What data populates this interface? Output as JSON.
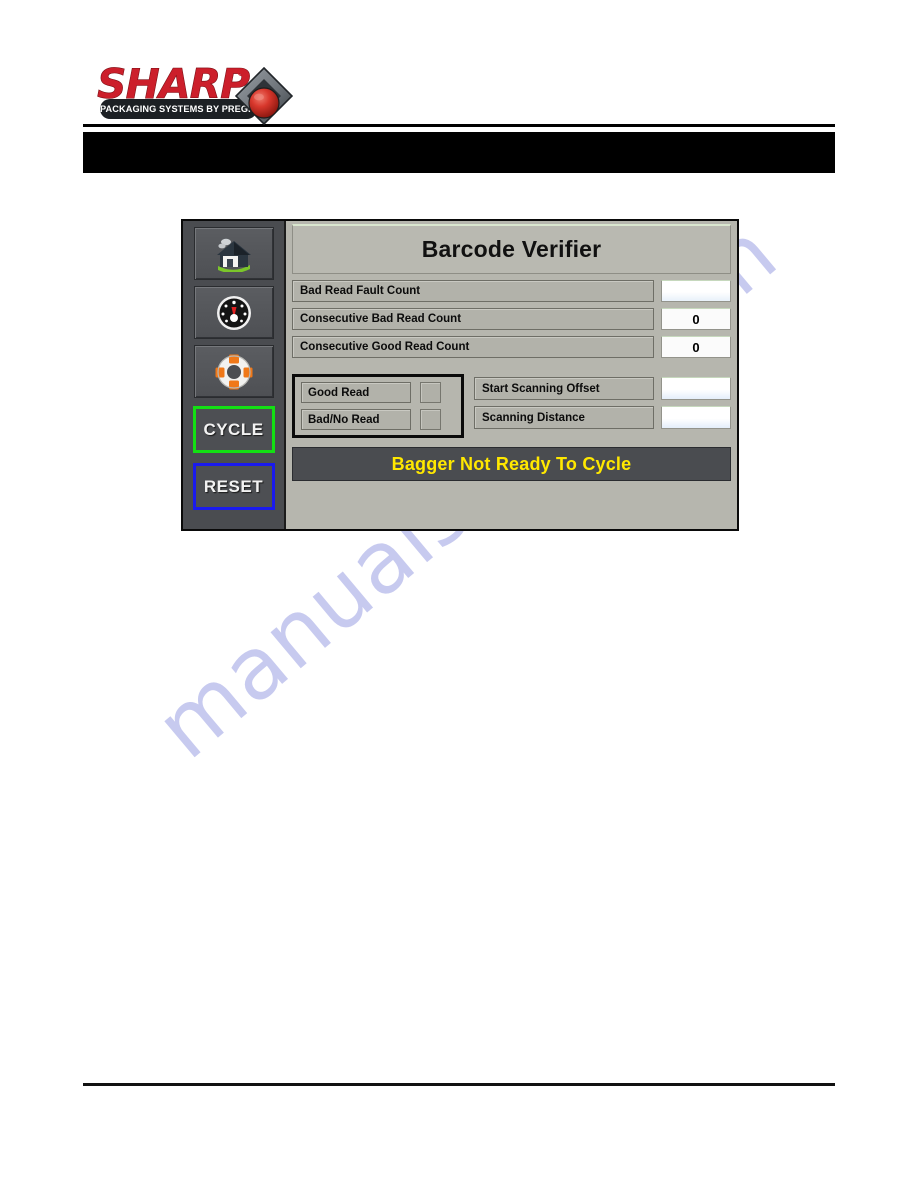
{
  "watermark": {
    "text": "manualshive.com"
  },
  "logo": {
    "brand": "SHARP",
    "registered_mark": "®",
    "tagline": "PACKAGING SYSTEMS BY PREGIS",
    "brand_color": "#cc1f2b",
    "tagline_bg": "#1c2024",
    "diamond_icon": "diamond-sphere-icon"
  },
  "header": {
    "bar_color": "#000000",
    "title": ""
  },
  "hmi": {
    "panel_title": "Barcode Verifier",
    "sidebar": {
      "nav_buttons": [
        {
          "icon": "home-icon",
          "label": "Home"
        },
        {
          "icon": "gauge-icon",
          "label": "Dashboard"
        },
        {
          "icon": "life-ring-icon",
          "label": "Help"
        }
      ],
      "action_buttons": [
        {
          "label": "CYCLE",
          "border_color": "#13e013"
        },
        {
          "label": "RESET",
          "border_color": "#1a1aee"
        }
      ]
    },
    "counters": [
      {
        "label": "Bad Read Fault Count",
        "value": ""
      },
      {
        "label": "Consecutive Bad Read Count",
        "value": "0"
      },
      {
        "label": "Consecutive Good Read Count",
        "value": "0"
      }
    ],
    "read_status": [
      {
        "label": "Good Read",
        "state": "off"
      },
      {
        "label": "Bad/No Read",
        "state": "off"
      }
    ],
    "scan_params": [
      {
        "label": "Start Scanning Offset",
        "value": ""
      },
      {
        "label": "Scanning Distance",
        "value": ""
      }
    ],
    "status_banner": {
      "text": "Bagger Not Ready To Cycle",
      "text_color": "#ffe800",
      "bg_color": "#4a4c50"
    }
  }
}
